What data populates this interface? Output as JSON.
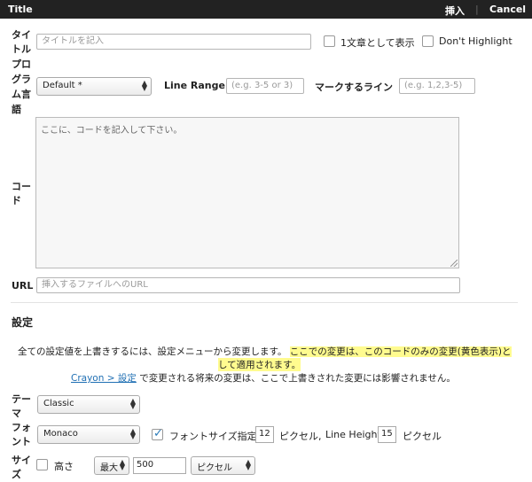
{
  "topbar": {
    "title": "Title",
    "insert": "挿入",
    "separator": "|",
    "cancel": "Cancel"
  },
  "title_row": {
    "label": "タイトル",
    "placeholder": "タイトルを記入",
    "inline_label": "1文章として表示",
    "no_highlight_label": "Don't Highlight"
  },
  "lang_row": {
    "label": "プログラム言語",
    "select_value": "Default *",
    "line_range_label": "Line Range",
    "line_range_placeholder": "(e.g. 3-5 or 3)",
    "mark_label": "マークするライン",
    "mark_placeholder": "(e.g. 1,2,3-5)"
  },
  "code_row": {
    "label": "コード",
    "placeholder": "ここに、コードを記入して下さい。"
  },
  "url_row": {
    "label": "URL",
    "placeholder": "挿入するファイルへのURL"
  },
  "settings": {
    "heading": "設定",
    "note_plain": "全ての設定値を上書きするには、設定メニューから変更します。",
    "note_highlight_1": "ここでの変更は、このコードのみの変更(黄色表示)と",
    "note_highlight_2": "して適用されます。",
    "link": "Crayon > 設定",
    "note_link_rest": " で変更される将来の変更は、ここで上書きされた変更には影響されません。"
  },
  "theme_row": {
    "label": "テーマ",
    "value": "Classic"
  },
  "font_row": {
    "label": "フォント",
    "value": "Monaco",
    "size_label": "フォントサイズ指定",
    "size_value": "12",
    "px_label": "ピクセル,",
    "line_height_label": "Line Height",
    "line_height_value": "15",
    "px_label_2": "ピクセル"
  },
  "size_row": {
    "label": "サイズ",
    "height_label": "高さ",
    "max_value": "最大",
    "height_value": "500",
    "unit_value": "ピクセル"
  }
}
